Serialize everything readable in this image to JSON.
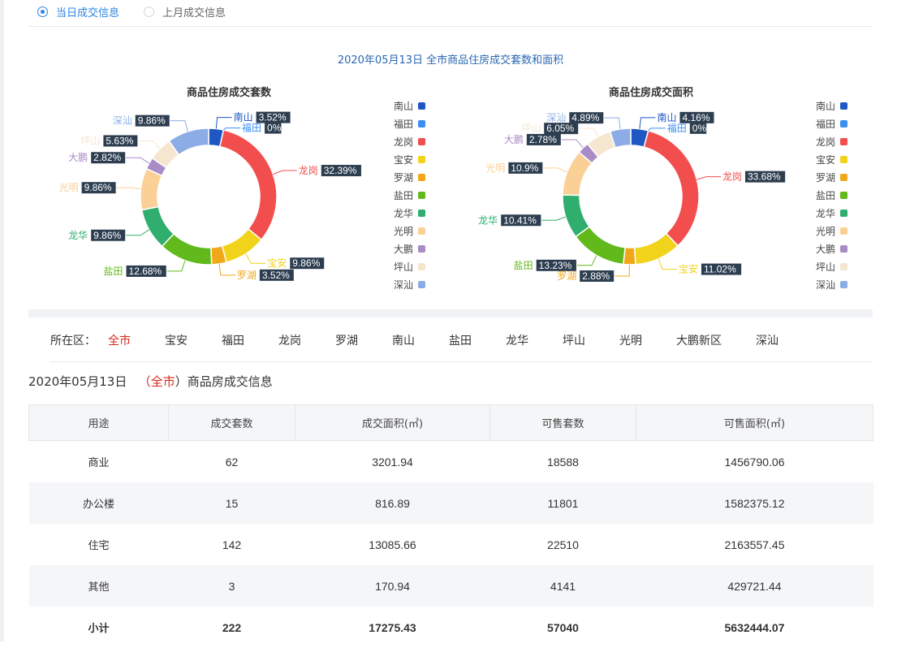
{
  "radios": [
    {
      "label": "当日成交信息",
      "active": true
    },
    {
      "label": "上月成交信息",
      "active": false
    }
  ],
  "page_title": "2020年05月13日 全市商品住房成交套数和面积",
  "colors": {
    "南山": "#1f57c3",
    "福田": "#3b8ff0",
    "龙岗": "#f24e4e",
    "宝安": "#f0d31a",
    "罗湖": "#f0a81a",
    "盐田": "#61b91b",
    "龙华": "#2fae6e",
    "光明": "#fad096",
    "大鹏": "#a88cc6",
    "坪山": "#f6e6cf",
    "深汕": "#8cace6"
  },
  "chart_data": [
    {
      "type": "pie",
      "title": "商品住房成交套数",
      "categories": [
        "南山",
        "福田",
        "龙岗",
        "宝安",
        "罗湖",
        "盐田",
        "龙华",
        "光明",
        "大鹏",
        "坪山",
        "深汕"
      ],
      "values": [
        3.52,
        0,
        32.39,
        9.86,
        3.52,
        12.68,
        9.86,
        9.86,
        2.82,
        5.63,
        9.86
      ],
      "labels": [
        "3.52%",
        "0%",
        "32.39%",
        "9.86%",
        "3.52%",
        "12.68%",
        "9.86%",
        "9.86%",
        "2.82%",
        "5.63%",
        "9.86%"
      ],
      "legend": "right"
    },
    {
      "type": "pie",
      "title": "商品住房成交面积",
      "categories": [
        "南山",
        "福田",
        "龙岗",
        "宝安",
        "罗湖",
        "盐田",
        "龙华",
        "光明",
        "大鹏",
        "坪山",
        "深汕"
      ],
      "values": [
        4.16,
        0,
        33.68,
        11.02,
        2.88,
        13.23,
        10.41,
        10.9,
        2.78,
        6.05,
        4.89
      ],
      "labels": [
        "4.16%",
        "0%",
        "33.68%",
        "11.02%",
        "2.88%",
        "13.23%",
        "10.41%",
        "10.9%",
        "2.78%",
        "6.05%",
        "4.89%"
      ],
      "legend": "right"
    }
  ],
  "filter": {
    "label": "所在区：",
    "districts": [
      "全市",
      "宝安",
      "福田",
      "龙岗",
      "罗湖",
      "南山",
      "盐田",
      "龙华",
      "坪山",
      "光明",
      "大鹏新区",
      "深汕"
    ],
    "active": "全市"
  },
  "info": {
    "date": "2020年05月13日",
    "open": "（",
    "district": "全市",
    "close": "）",
    "suffix": "商品房成交信息"
  },
  "table": {
    "headers": [
      "用途",
      "成交套数",
      "成交面积(㎡)",
      "可售套数",
      "可售面积(㎡)"
    ],
    "rows": [
      [
        "商业",
        "62",
        "3201.94",
        "18588",
        "1456790.06"
      ],
      [
        "办公楼",
        "15",
        "816.89",
        "11801",
        "1582375.12"
      ],
      [
        "住宅",
        "142",
        "13085.66",
        "22510",
        "2163557.45"
      ],
      [
        "其他",
        "3",
        "170.94",
        "4141",
        "429721.44"
      ],
      [
        "小计",
        "222",
        "17275.43",
        "57040",
        "5632444.07"
      ]
    ]
  }
}
